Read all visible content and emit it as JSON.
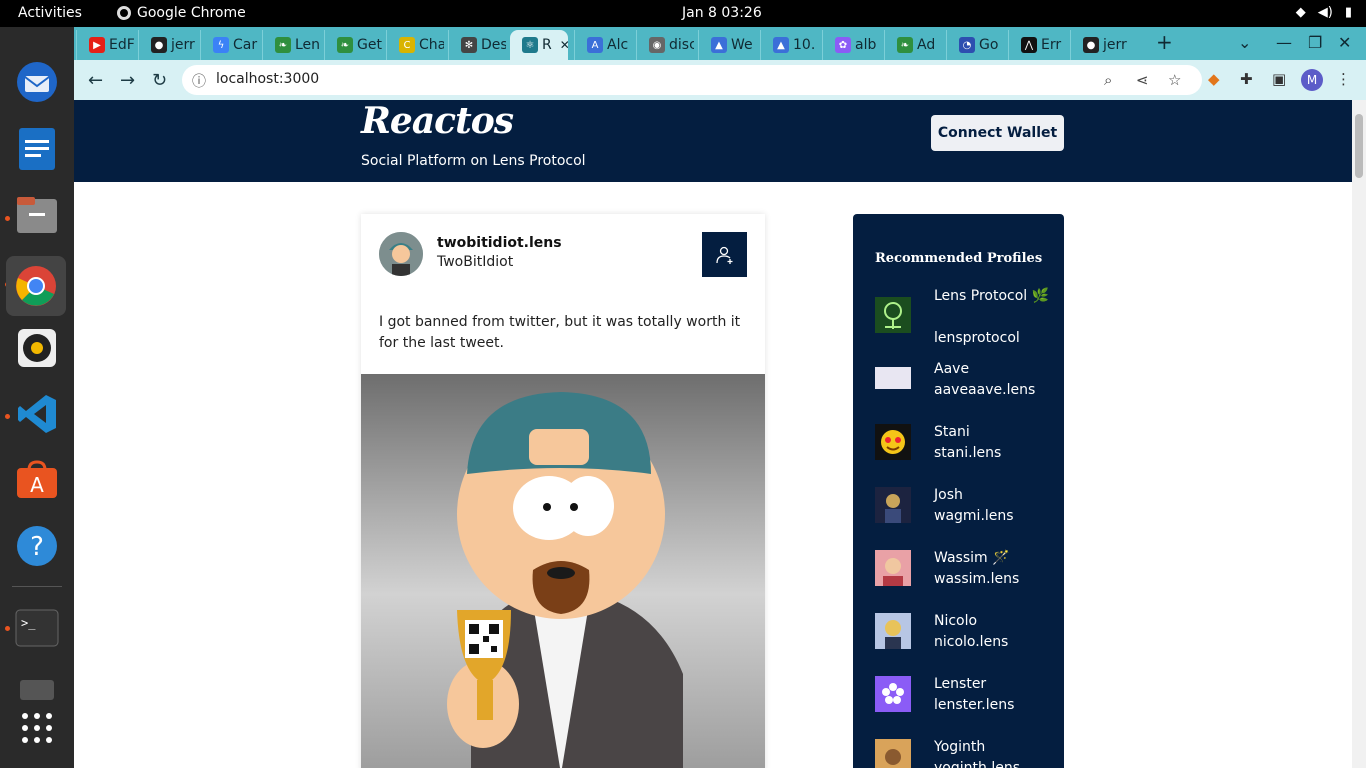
{
  "system": {
    "activities": "Activities",
    "app_name": "Google Chrome",
    "clock": "Jan 8  03:26"
  },
  "tabs": [
    {
      "label": "EdF",
      "icon": "youtube-icon",
      "color": "#e62117"
    },
    {
      "label": "jerr",
      "icon": "github-icon",
      "color": "#222222"
    },
    {
      "label": "Car",
      "icon": "bolt-icon",
      "color": "#3b82f6"
    },
    {
      "label": "Len",
      "icon": "leaf-icon",
      "color": "#2f8f3e"
    },
    {
      "label": "Get",
      "icon": "leaf-icon",
      "color": "#2f8f3e"
    },
    {
      "label": "Cha",
      "icon": "c-icon",
      "color": "#d9b400"
    },
    {
      "label": "Des",
      "icon": "openai-icon",
      "color": "#444444"
    },
    {
      "label": "R",
      "icon": "react-icon",
      "color": "#1e7a8c",
      "active": true
    },
    {
      "label": "Alc",
      "icon": "alchemy-icon",
      "color": "#3b6fd8"
    },
    {
      "label": "disc",
      "icon": "discord-icon",
      "color": "#666666"
    },
    {
      "label": "We",
      "icon": "triangle-icon",
      "color": "#3b6fd8"
    },
    {
      "label": "10.",
      "icon": "triangle-icon",
      "color": "#3b6fd8"
    },
    {
      "label": "alb",
      "icon": "flower-icon",
      "color": "#8b5cf6"
    },
    {
      "label": "Ad",
      "icon": "leaf-icon",
      "color": "#2f8f3e"
    },
    {
      "label": "Go",
      "icon": "chart-icon",
      "color": "#2d4fb0"
    },
    {
      "label": "Err",
      "icon": "vercel-icon",
      "color": "#111111"
    },
    {
      "label": "jerr",
      "icon": "github-icon",
      "color": "#222222"
    }
  ],
  "address_bar": {
    "url": "localhost:3000"
  },
  "header": {
    "brand": "Reactos",
    "tagline": "Social Platform on Lens Protocol",
    "connect_label": "Connect Wallet"
  },
  "post": {
    "handle": "twobitidiot.lens",
    "name": "TwoBitIdiot",
    "text": "I got banned from twitter, but it was totally worth it for the last tweet."
  },
  "sidebar": {
    "title": "Recommended Profiles",
    "profiles": [
      {
        "name": "Lens Protocol 🌿",
        "handle": "lensprotocol"
      },
      {
        "name": "Aave",
        "handle": "aaveaave.lens"
      },
      {
        "name": "Stani",
        "handle": "stani.lens"
      },
      {
        "name": "Josh",
        "handle": "wagmi.lens"
      },
      {
        "name": "Wassim 🪄",
        "handle": "wassim.lens"
      },
      {
        "name": "Nicolo",
        "handle": "nicolo.lens"
      },
      {
        "name": "Lenster",
        "handle": "lenster.lens"
      },
      {
        "name": "Yoginth",
        "handle": "yoginth.lens"
      }
    ]
  }
}
